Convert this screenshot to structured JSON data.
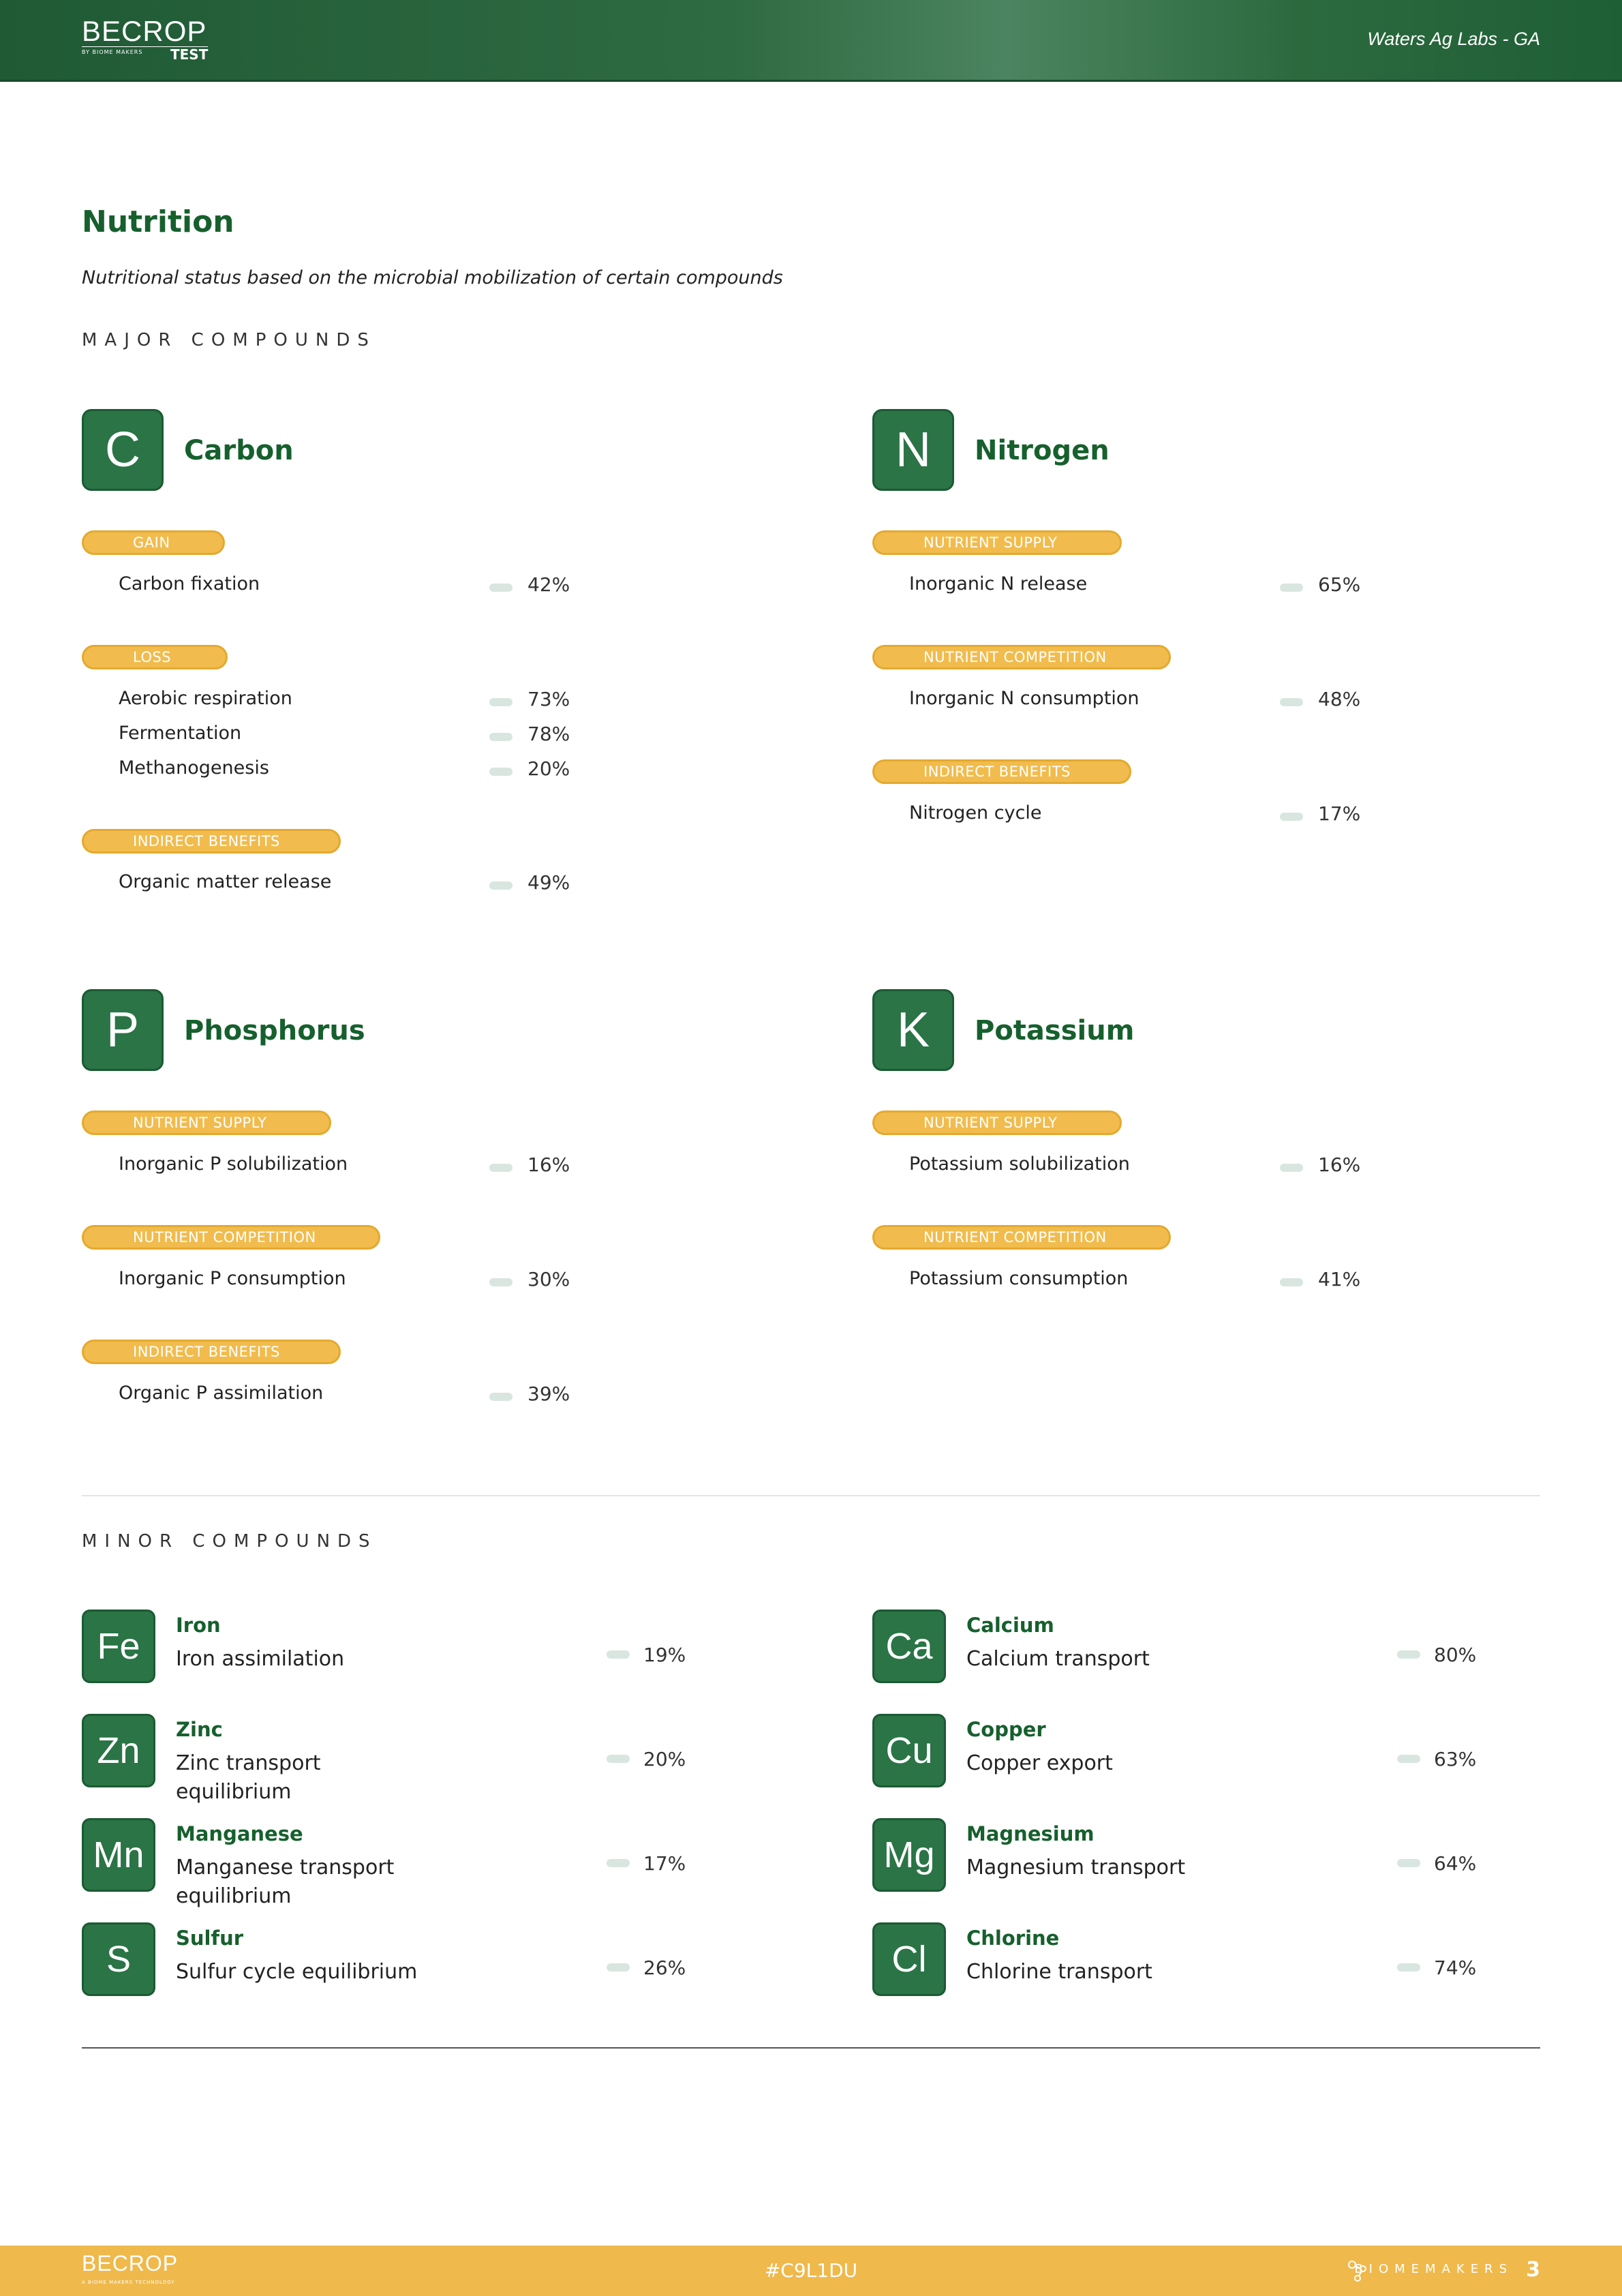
{
  "header": {
    "logo_main": "BECROP",
    "logo_sub": "BY BIOME MAKERS",
    "logo_test": "TEST",
    "lab_name": "Waters Ag Labs - GA"
  },
  "page": {
    "title": "Nutrition",
    "subtitle": "Nutritional status based on the microbial mobilization of certain compounds",
    "major_label": "MAJOR COMPOUNDS",
    "minor_label": "MINOR COMPOUNDS"
  },
  "major": {
    "carbon": {
      "symbol": "C",
      "name": "Carbon",
      "groups": [
        {
          "label": "GAIN",
          "rows": [
            {
              "label": "Carbon fixation",
              "pct": "42%"
            }
          ]
        },
        {
          "label": "LOSS",
          "rows": [
            {
              "label": "Aerobic respiration",
              "pct": "73%"
            },
            {
              "label": "Fermentation",
              "pct": "78%"
            },
            {
              "label": "Methanogenesis",
              "pct": "20%"
            }
          ]
        },
        {
          "label": "INDIRECT BENEFITS",
          "rows": [
            {
              "label": "Organic matter release",
              "pct": "49%"
            }
          ]
        }
      ]
    },
    "nitrogen": {
      "symbol": "N",
      "name": "Nitrogen",
      "groups": [
        {
          "label": "NUTRIENT SUPPLY",
          "rows": [
            {
              "label": "Inorganic N release",
              "pct": "65%"
            }
          ]
        },
        {
          "label": "NUTRIENT COMPETITION",
          "rows": [
            {
              "label": "Inorganic N consumption",
              "pct": "48%"
            }
          ]
        },
        {
          "label": "INDIRECT BENEFITS",
          "rows": [
            {
              "label": "Nitrogen cycle",
              "pct": "17%"
            }
          ]
        }
      ]
    },
    "phosphorus": {
      "symbol": "P",
      "name": "Phosphorus",
      "groups": [
        {
          "label": "NUTRIENT SUPPLY",
          "rows": [
            {
              "label": "Inorganic P solubilization",
              "pct": "16%"
            }
          ]
        },
        {
          "label": "NUTRIENT COMPETITION",
          "rows": [
            {
              "label": "Inorganic P consumption",
              "pct": "30%"
            }
          ]
        },
        {
          "label": "INDIRECT BENEFITS",
          "rows": [
            {
              "label": "Organic P assimilation",
              "pct": "39%"
            }
          ]
        }
      ]
    },
    "potassium": {
      "symbol": "K",
      "name": "Potassium",
      "groups": [
        {
          "label": "NUTRIENT SUPPLY",
          "rows": [
            {
              "label": "Potassium solubilization",
              "pct": "16%"
            }
          ]
        },
        {
          "label": "NUTRIENT COMPETITION",
          "rows": [
            {
              "label": "Potassium consumption",
              "pct": "41%"
            }
          ]
        }
      ]
    }
  },
  "minor": [
    {
      "symbol": "Fe",
      "name": "Iron",
      "desc": "Iron assimilation",
      "pct": "19%"
    },
    {
      "symbol": "Ca",
      "name": "Calcium",
      "desc": "Calcium transport",
      "pct": "80%"
    },
    {
      "symbol": "Zn",
      "name": "Zinc",
      "desc": "Zinc transport equilibrium",
      "pct": "20%"
    },
    {
      "symbol": "Cu",
      "name": "Copper",
      "desc": "Copper export",
      "pct": "63%"
    },
    {
      "symbol": "Mn",
      "name": "Manganese",
      "desc": "Manganese transport equilibrium",
      "pct": "17%"
    },
    {
      "symbol": "Mg",
      "name": "Magnesium",
      "desc": "Magnesium transport",
      "pct": "64%"
    },
    {
      "symbol": "S",
      "name": "Sulfur",
      "desc": "Sulfur cycle equilibrium",
      "pct": "26%"
    },
    {
      "symbol": "Cl",
      "name": "Chlorine",
      "desc": "Chlorine transport",
      "pct": "74%"
    }
  ],
  "footer": {
    "logo": "BECROP",
    "logo_sub": "A BIOME MAKERS TECHNOLOGY",
    "code": "#C9L1DU",
    "brand": "BIOMEMAKERS",
    "page_number": "3"
  }
}
